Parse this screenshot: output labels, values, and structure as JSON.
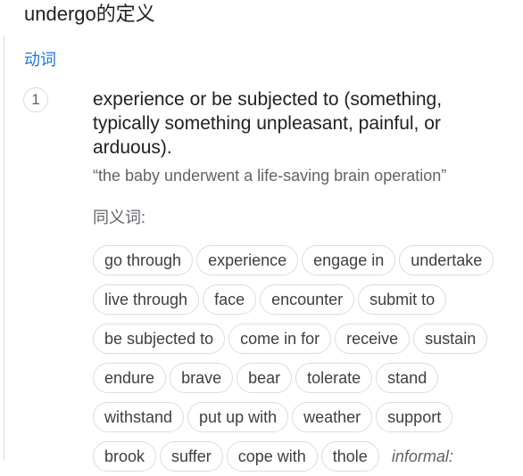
{
  "header": {
    "title": "undergo的定义"
  },
  "entry": {
    "part_of_speech": "动词",
    "sense_number": "1",
    "definition": "experience or be subjected to (something, typically something unpleasant, painful, or arduous).",
    "example": "“the baby underwent a life-saving brain operation”",
    "synonyms_label": "同义词:",
    "synonyms": [
      [
        "go through",
        "experience",
        "engage in",
        "undertake"
      ],
      [
        "live through",
        "face",
        "encounter",
        "submit to"
      ],
      [
        "be subjected to",
        "come in for",
        "receive",
        "sustain"
      ],
      [
        "endure",
        "brave",
        "bear",
        "tolerate",
        "stand"
      ],
      [
        "withstand",
        "put up with",
        "weather",
        "support"
      ],
      [
        "brook",
        "suffer",
        "cope with",
        "thole"
      ]
    ],
    "register_label": "informal:"
  }
}
